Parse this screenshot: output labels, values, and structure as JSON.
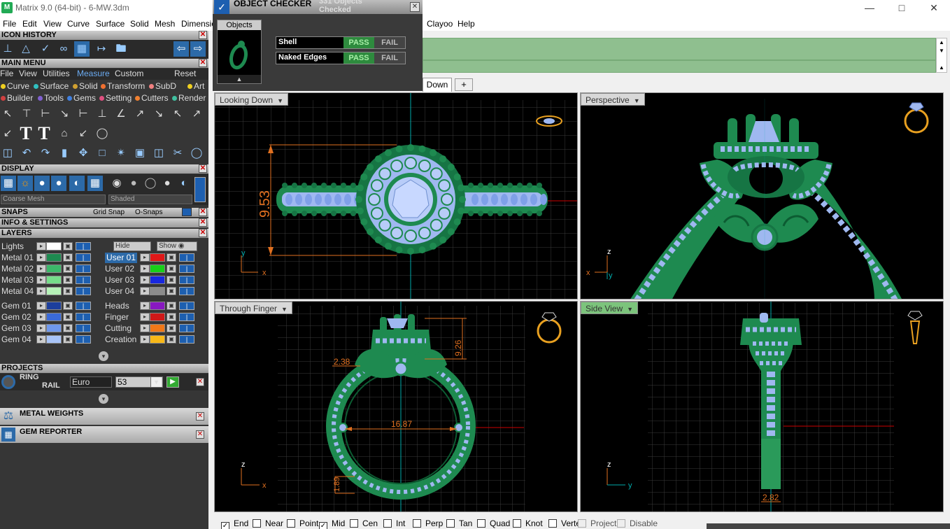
{
  "app": {
    "title": "Matrix 9.0 (64-bit) - 6-MW.3dm",
    "icon_name": "matrix-app-icon",
    "window_controls": [
      "minimize",
      "maximize",
      "close"
    ]
  },
  "menubar": {
    "left_items": [
      "File",
      "Edit",
      "View",
      "Curve",
      "Surface",
      "Solid",
      "Mesh",
      "Dimension"
    ],
    "right_items": [
      "Clayoo",
      "Help"
    ]
  },
  "panels": {
    "icon_history": "ICON HISTORY",
    "main_menu": "MAIN MENU",
    "display": "DISPLAY",
    "snaps": "SNAPS",
    "info_settings": "INFO & SETTINGS",
    "layers": "LAYERS",
    "projects": "PROJECTS",
    "metal_weights": "METAL WEIGHTS",
    "gem_reporter": "GEM REPORTER"
  },
  "main_menu": {
    "tabs": [
      "File",
      "View",
      "Utilities",
      "Measure",
      "Custom"
    ],
    "active_tab": "Measure",
    "reset": "Reset",
    "categories_row1": [
      {
        "label": "Curve",
        "color": "#f0d020"
      },
      {
        "label": "Surface",
        "color": "#30c0c0"
      },
      {
        "label": "Solid",
        "color": "#d0a030"
      },
      {
        "label": "Transform",
        "color": "#f07030"
      },
      {
        "label": "SubD",
        "color": "#f08080"
      },
      {
        "label": "Art",
        "color": "#f0d020"
      }
    ],
    "categories_row2": [
      {
        "label": "Builder",
        "color": "#d04040"
      },
      {
        "label": "Tools",
        "color": "#8060d0"
      },
      {
        "label": "Gems",
        "color": "#4080e0"
      },
      {
        "label": "Setting",
        "color": "#e05080"
      },
      {
        "label": "Cutters",
        "color": "#f08030"
      },
      {
        "label": "Render",
        "color": "#40c0a0"
      }
    ]
  },
  "display": {
    "mesh_mode": "Coarse Mesh",
    "shade_mode": "Shaded"
  },
  "snaps": {
    "grid_snap": "Grid Snap",
    "osnaps": "O-Snaps"
  },
  "layers": {
    "lights_label": "Lights",
    "hide_label": "Hide",
    "show_label": "Show",
    "left_group1": [
      {
        "name": "Metal 01",
        "color": "#1e8a50"
      },
      {
        "name": "Metal 02",
        "color": "#3cb86a"
      },
      {
        "name": "Metal 03",
        "color": "#76dd8a"
      },
      {
        "name": "Metal 04",
        "color": "#b6f2b8"
      }
    ],
    "left_group2": [
      {
        "name": "Gem 01",
        "color": "#1c3e9c"
      },
      {
        "name": "Gem 02",
        "color": "#3a6ad8"
      },
      {
        "name": "Gem 03",
        "color": "#6f98ec"
      },
      {
        "name": "Gem 04",
        "color": "#a8c4f8"
      }
    ],
    "right_group1": [
      {
        "name": "User 01",
        "color": "#e01818"
      },
      {
        "name": "User 02",
        "color": "#18d018"
      },
      {
        "name": "User 03",
        "color": "#1828e0"
      },
      {
        "name": "User 04",
        "color": "#8c8c8c"
      }
    ],
    "right_group2": [
      {
        "name": "Heads",
        "color": "#8818c0"
      },
      {
        "name": "Finger",
        "color": "#d01818"
      },
      {
        "name": "Cutting",
        "color": "#f07818"
      },
      {
        "name": "Creation",
        "color": "#f8b818"
      }
    ]
  },
  "projects": {
    "line1": "RING",
    "line2": "RAIL",
    "size_system": "Euro",
    "size_value": "53"
  },
  "object_checker": {
    "title": "OBJECT CHECKER",
    "count": "331 Objects Checked",
    "objects_label": "Objects",
    "rows": [
      {
        "label": "Shell",
        "pass": "PASS",
        "fail": "FAIL"
      },
      {
        "label": "Naked Edges",
        "pass": "PASS",
        "fail": "FAIL"
      }
    ]
  },
  "tabs": {
    "active": "Down",
    "add": "+"
  },
  "viewports": {
    "top_left": {
      "label": "Looking Down",
      "dimension": "9.53",
      "axis_v": "y",
      "axis_h": "x"
    },
    "top_right": {
      "label": "Perspective",
      "axis_v": "z",
      "axis_h": "x",
      "axis_d": "y"
    },
    "bottom_left": {
      "label": "Through Finger",
      "dimensions": [
        "2.38",
        "9.26",
        "16.87",
        "1.89"
      ],
      "axis_v": "z",
      "axis_h": "x"
    },
    "bottom_right": {
      "label": "Side View",
      "dimension": "2.82",
      "axis_v": "z",
      "axis_h": "y"
    }
  },
  "snapbar": [
    {
      "label": "End",
      "checked": true
    },
    {
      "label": "Near",
      "checked": false
    },
    {
      "label": "Point",
      "checked": false
    },
    {
      "label": "Mid",
      "checked": true
    },
    {
      "label": "Cen",
      "checked": false
    },
    {
      "label": "Int",
      "checked": false
    },
    {
      "label": "Perp",
      "checked": false
    },
    {
      "label": "Tan",
      "checked": false
    },
    {
      "label": "Quad",
      "checked": false
    },
    {
      "label": "Knot",
      "checked": false
    },
    {
      "label": "Vertex",
      "checked": false
    },
    {
      "label": "Project",
      "checked": false,
      "disabled": true
    },
    {
      "label": "Disable",
      "checked": false,
      "disabled": true
    }
  ],
  "colors": {
    "metal_green": "#1e8a50",
    "gem_blue": "#9fb8f0",
    "dimension_orange": "#e07020",
    "command_area_green": "#8fbf8f",
    "pass_green": "#2e8b3e"
  }
}
